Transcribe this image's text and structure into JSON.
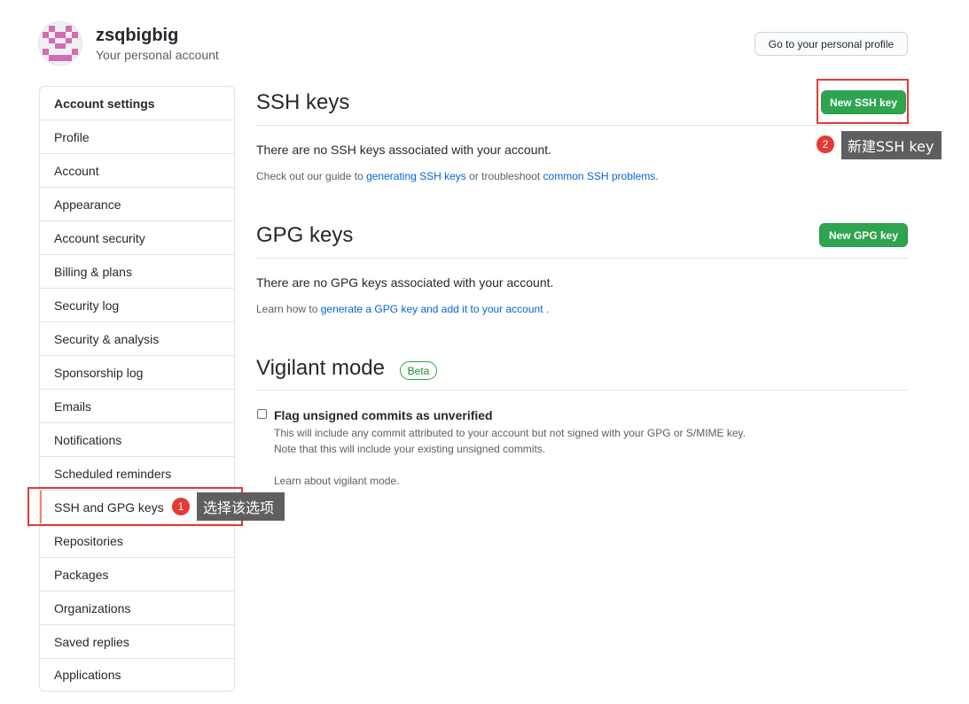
{
  "header": {
    "username": "zsqbigbig",
    "subtitle": "Your personal account",
    "profile_button": "Go to your personal profile",
    "avatar_icon": "identicon-avatar"
  },
  "sidebar": {
    "heading": "Account settings",
    "items": [
      {
        "label": "Profile"
      },
      {
        "label": "Account"
      },
      {
        "label": "Appearance"
      },
      {
        "label": "Account security"
      },
      {
        "label": "Billing & plans"
      },
      {
        "label": "Security log"
      },
      {
        "label": "Security & analysis"
      },
      {
        "label": "Sponsorship log"
      },
      {
        "label": "Emails"
      },
      {
        "label": "Notifications"
      },
      {
        "label": "Scheduled reminders"
      },
      {
        "label": "SSH and GPG keys",
        "selected": true
      },
      {
        "label": "Repositories"
      },
      {
        "label": "Packages"
      },
      {
        "label": "Organizations"
      },
      {
        "label": "Saved replies"
      },
      {
        "label": "Applications"
      }
    ]
  },
  "ssh": {
    "title": "SSH keys",
    "button": "New SSH key",
    "empty": "There are no SSH keys associated with your account.",
    "guide_prefix": "Check out our guide to ",
    "guide_link1": "generating SSH keys",
    "guide_middle": " or troubleshoot ",
    "guide_link2": "common SSH problems",
    "guide_suffix": "."
  },
  "gpg": {
    "title": "GPG keys",
    "button": "New GPG key",
    "empty": "There are no GPG keys associated with your account.",
    "learn_prefix": "Learn how to ",
    "learn_link": "generate a GPG key and add it to your account",
    "learn_suffix": " ."
  },
  "vigilant": {
    "title": "Vigilant mode",
    "badge": "Beta",
    "checkbox_label": "Flag unsigned commits as unverified",
    "checked": false,
    "note1": "This will include any commit attributed to your account but not signed with your GPG or S/MIME key.",
    "note2": "Note that this will include your existing unsigned commits.",
    "learn_link": "Learn about vigilant mode."
  },
  "annotations": {
    "step1_number": "1",
    "step1_text": "选择该选项",
    "step2_number": "2",
    "step2_text": "新建SSH key",
    "highlight_color": "#e53935"
  },
  "colors": {
    "primary_button": "#2ea44f",
    "link": "#0366d6",
    "selected_indicator": "#f9826c",
    "avatar_pattern": "#d36bb5"
  }
}
